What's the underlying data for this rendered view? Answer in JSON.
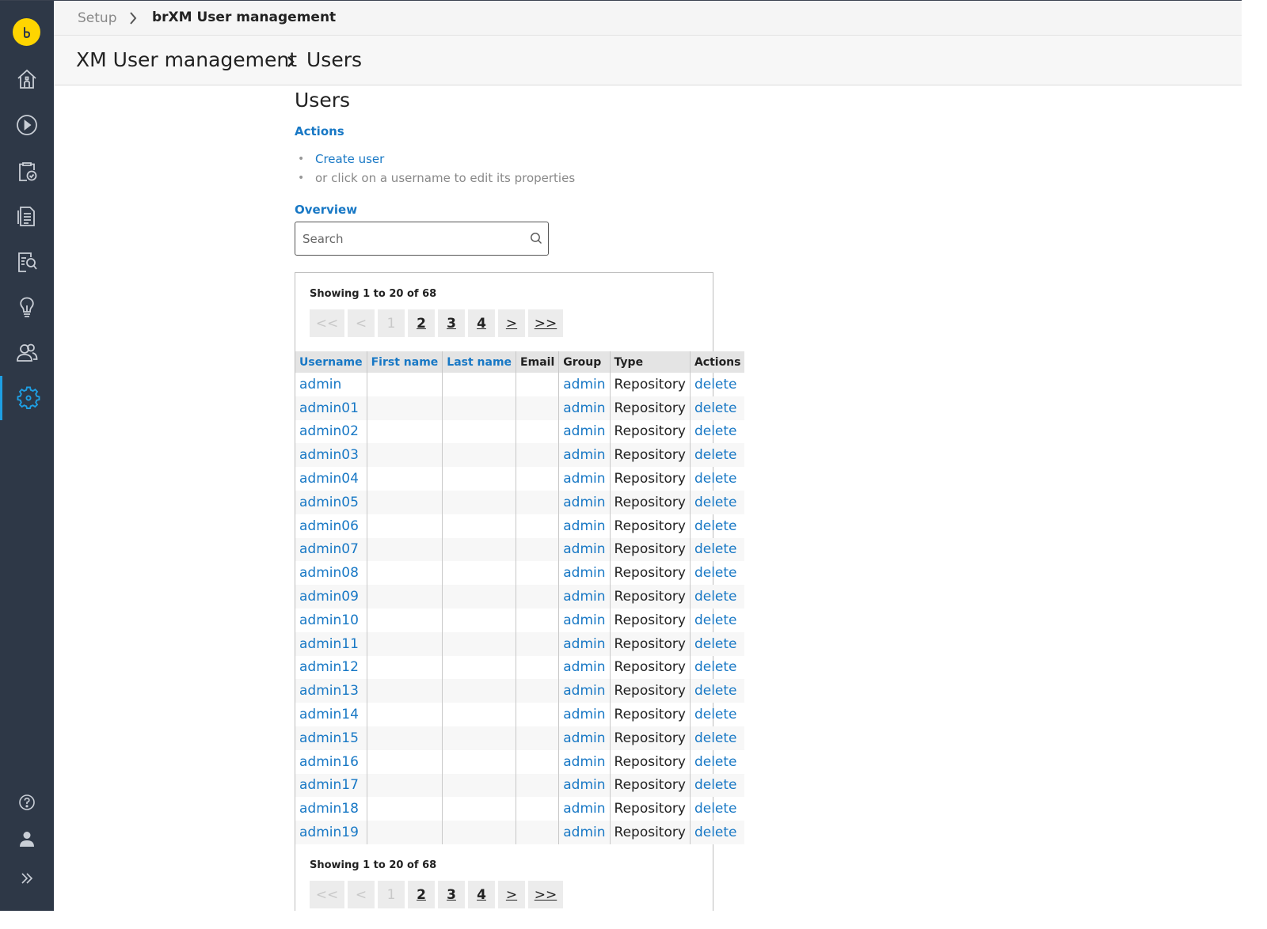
{
  "breadcrumb": {
    "root": "Setup",
    "current": "brXM User management"
  },
  "header": {
    "title": "XM User management",
    "subtitle": "Users"
  },
  "page": {
    "title": "Users"
  },
  "actions": {
    "label": "Actions",
    "create_user": "Create user",
    "hint": "or click on a username to edit its properties"
  },
  "overview": {
    "label": "Overview",
    "search_placeholder": "Search"
  },
  "pagination": {
    "summary": "Showing 1 to 20 of 68",
    "first": "<<",
    "prev": "<",
    "page1": "1",
    "page2": "2",
    "page3": "3",
    "page4": "4",
    "next": ">",
    "last": ">>"
  },
  "table": {
    "headers": [
      "Username",
      "First name",
      "Last name",
      "Email",
      "Group",
      "Type",
      "Actions"
    ],
    "rows": [
      {
        "username": "admin",
        "group": "admin",
        "type": "Repository",
        "action": "delete"
      },
      {
        "username": "admin01",
        "group": "admin",
        "type": "Repository",
        "action": "delete"
      },
      {
        "username": "admin02",
        "group": "admin",
        "type": "Repository",
        "action": "delete"
      },
      {
        "username": "admin03",
        "group": "admin",
        "type": "Repository",
        "action": "delete"
      },
      {
        "username": "admin04",
        "group": "admin",
        "type": "Repository",
        "action": "delete"
      },
      {
        "username": "admin05",
        "group": "admin",
        "type": "Repository",
        "action": "delete"
      },
      {
        "username": "admin06",
        "group": "admin",
        "type": "Repository",
        "action": "delete"
      },
      {
        "username": "admin07",
        "group": "admin",
        "type": "Repository",
        "action": "delete"
      },
      {
        "username": "admin08",
        "group": "admin",
        "type": "Repository",
        "action": "delete"
      },
      {
        "username": "admin09",
        "group": "admin",
        "type": "Repository",
        "action": "delete"
      },
      {
        "username": "admin10",
        "group": "admin",
        "type": "Repository",
        "action": "delete"
      },
      {
        "username": "admin11",
        "group": "admin",
        "type": "Repository",
        "action": "delete"
      },
      {
        "username": "admin12",
        "group": "admin",
        "type": "Repository",
        "action": "delete"
      },
      {
        "username": "admin13",
        "group": "admin",
        "type": "Repository",
        "action": "delete"
      },
      {
        "username": "admin14",
        "group": "admin",
        "type": "Repository",
        "action": "delete"
      },
      {
        "username": "admin15",
        "group": "admin",
        "type": "Repository",
        "action": "delete"
      },
      {
        "username": "admin16",
        "group": "admin",
        "type": "Repository",
        "action": "delete"
      },
      {
        "username": "admin17",
        "group": "admin",
        "type": "Repository",
        "action": "delete"
      },
      {
        "username": "admin18",
        "group": "admin",
        "type": "Repository",
        "action": "delete"
      },
      {
        "username": "admin19",
        "group": "admin",
        "type": "Repository",
        "action": "delete"
      }
    ]
  },
  "colors": {
    "sidebar": "#2e3847",
    "accent": "#1878c5",
    "logo": "#ffd500",
    "active_icon": "#1e9fe4"
  },
  "sidebar": {
    "icons": [
      "home-icon",
      "play-icon",
      "clipboard-check-icon",
      "document-icon",
      "document-search-icon",
      "lightbulb-icon",
      "users-icon",
      "gear-icon"
    ],
    "bottom_icons": [
      "help-icon",
      "user-icon",
      "expand-icon"
    ]
  }
}
